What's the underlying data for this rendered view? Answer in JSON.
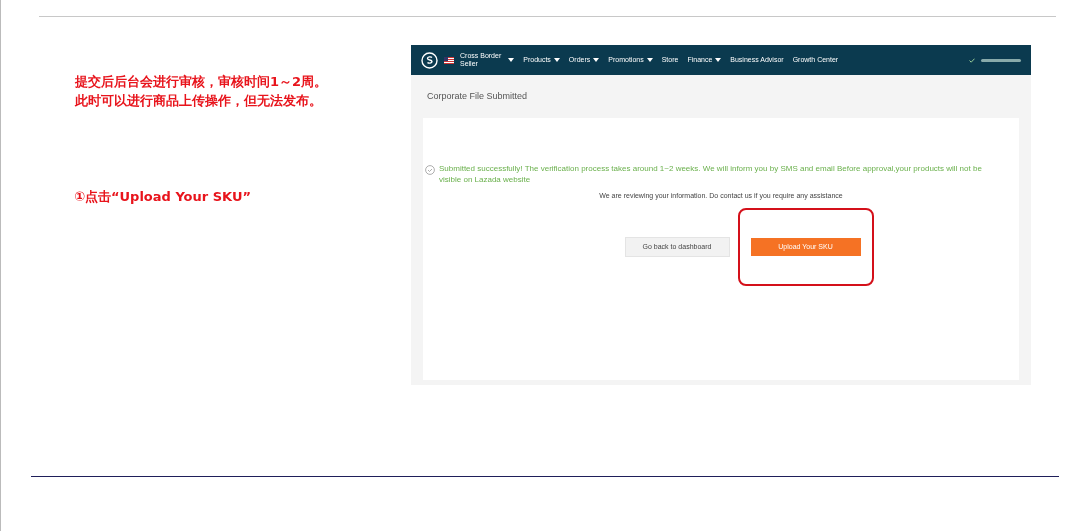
{
  "notes": [
    {
      "text": "提交后后台会进行审核，审核时间1～2周。"
    },
    {
      "text": "此时可以进行商品上传操作，但无法发布。"
    }
  ],
  "step": {
    "text": "①点击“Upload Your SKU”"
  },
  "screenshot": {
    "nav": {
      "seller": [
        "Cross Border",
        "Seller"
      ],
      "items": [
        {
          "label": "Products",
          "dropdown": true
        },
        {
          "label": "Orders",
          "dropdown": true
        },
        {
          "label": "Promotions",
          "dropdown": true
        },
        {
          "label": "Store",
          "dropdown": false
        },
        {
          "label": "Finance",
          "dropdown": true
        },
        {
          "label": "Business Advisor",
          "dropdown": false
        },
        {
          "label": "Growth Center",
          "dropdown": false
        }
      ]
    },
    "page_title": "Corporate File Submitted",
    "success_message": "Submitted successfully! The verification process takes around 1~2 weeks. We will inform you by SMS and email Before approval,your products will not be visible on Lazada website",
    "sub_message": "We are reviewing your information. Do contact us if you require any assistance",
    "buttons": [
      {
        "label": "Go back to dashboard",
        "kind": "secondary",
        "highlighted": false
      },
      {
        "label": "Upload Your SKU",
        "kind": "primary",
        "highlighted": true
      }
    ]
  }
}
